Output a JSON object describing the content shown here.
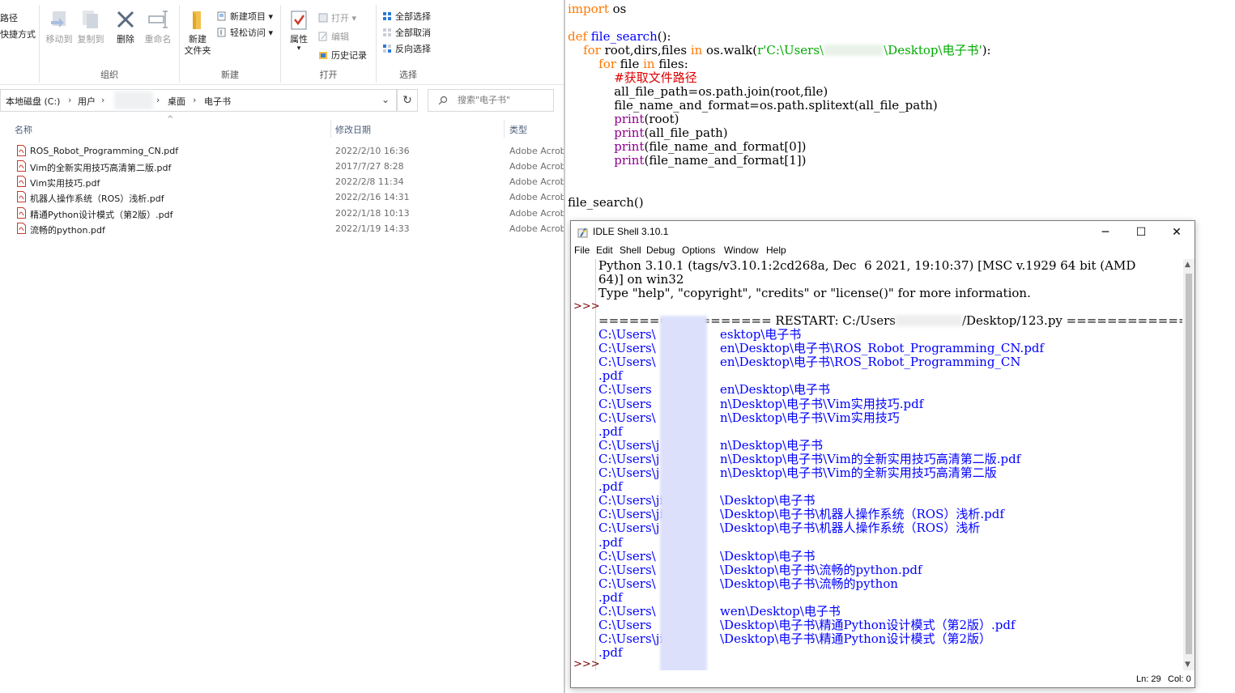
{
  "explorer": {
    "ribbon": {
      "cut_partial_label": "路径",
      "paste_shortcut_partial_label": "快捷方式",
      "move_to": "移动到",
      "copy_to": "复制到",
      "delete": "删除",
      "rename": "重命名",
      "new_folder_line1": "新建",
      "new_folder_line2": "文件夹",
      "new_item": "新建项目",
      "easy_access": "轻松访问",
      "properties": "属性",
      "open": "打开",
      "edit": "编辑",
      "history": "历史记录",
      "select_all": "全部选择",
      "select_none": "全部取消",
      "invert_selection": "反向选择",
      "groups": {
        "organize": "组织",
        "new": "新建",
        "open": "打开",
        "select": "选择"
      }
    },
    "breadcrumb": {
      "drive": "本地磁盘 (C:)",
      "users": "用户",
      "desktop": "桌面",
      "folder": "电子书"
    },
    "search_placeholder": "搜索\"电子书\"",
    "columns": {
      "name": "名称",
      "modified": "修改日期",
      "type": "类型"
    },
    "files": [
      {
        "name": "ROS_Robot_Programming_CN.pdf",
        "modified": "2022/2/10 16:36",
        "type": "Adobe Acrob"
      },
      {
        "name": "Vim的全新实用技巧高清第二版.pdf",
        "modified": "2017/7/27 8:28",
        "type": "Adobe Acrob"
      },
      {
        "name": "Vim实用技巧.pdf",
        "modified": "2022/2/8 11:34",
        "type": "Adobe Acrob"
      },
      {
        "name": "机器人操作系统（ROS）浅析.pdf",
        "modified": "2022/2/16 14:31",
        "type": "Adobe Acrob"
      },
      {
        "name": "精通Python设计模式（第2版）.pdf",
        "modified": "2022/1/18 10:13",
        "type": "Adobe Acrob"
      },
      {
        "name": "流畅的python.pdf",
        "modified": "2022/1/19 14:33",
        "type": "Adobe Acrob"
      }
    ]
  },
  "editor": {
    "l1_kw": "import",
    "l1_rest": " os",
    "l2_kw": "def",
    "l2_fn": " file_search",
    "l2_rest": "():",
    "l3_kw1": "    for",
    "l3_a": " root,dirs,files ",
    "l3_kw2": "in",
    "l3_b": " os.walk(",
    "l3_str1": "r'C:\\Users\\",
    "l3_str2": "\\Desktop\\电子书'",
    "l3_c": "):",
    "l4_kw1": "        for",
    "l4_a": " file ",
    "l4_kw2": "in",
    "l4_b": " files:",
    "l5_comment": "            #获取文件路径",
    "l6": "            all_file_path=os.path.join(root,file)",
    "l7": "            file_name_and_format=os.path.splitext(all_file_path)",
    "l8_kw": "            print",
    "l8_rest": "(root)",
    "l9_kw": "            print",
    "l9_rest": "(all_file_path)",
    "l10_kw": "            print",
    "l10_rest": "(file_name_and_format[0])",
    "l11_kw": "            print",
    "l11_rest": "(file_name_and_format[1])",
    "l12": "file_search()"
  },
  "shell": {
    "title": "IDLE Shell 3.10.1",
    "menus": [
      "File",
      "Edit",
      "Shell",
      "Debug",
      "Options",
      "Window",
      "Help"
    ],
    "prompt": ">>>",
    "banner1": "Python 3.10.1 (tags/v3.10.1:2cd268a, Dec  6 2021, 19:10:37) [MSC v.1929 64 bit (AMD",
    "banner2": "64)] on win32",
    "banner3": "Type \"help\", \"copyright\", \"credits\" or \"license()\" for more information.",
    "restart_a": "================= RESTART: C:/Users",
    "restart_b": "/Desktop/123.py ==================",
    "output": [
      "C:\\Users\\",
      "C:\\Users\\",
      "C:\\Users\\",
      ".pdf",
      "C:\\Users",
      "C:\\Users",
      "C:\\Users\\",
      ".pdf",
      "C:\\Users\\j",
      "C:\\Users\\j",
      "C:\\Users\\j",
      ".pdf",
      "C:\\Users\\ji",
      "C:\\Users\\ji",
      "C:\\Users\\j",
      ".pdf",
      "C:\\Users\\",
      "C:\\Users\\",
      "C:\\Users\\",
      ".pdf",
      "C:\\Users\\",
      "C:\\Users",
      "C:\\Users\\jing.",
      ".pdf"
    ],
    "output_tail": [
      "esktop\\电子书",
      "en\\Desktop\\电子书\\ROS_Robot_Programming_CN.pdf",
      "en\\Desktop\\电子书\\ROS_Robot_Programming_CN",
      "",
      "en\\Desktop\\电子书",
      "n\\Desktop\\电子书\\Vim实用技巧.pdf",
      "n\\Desktop\\电子书\\Vim实用技巧",
      "",
      "n\\Desktop\\电子书",
      "n\\Desktop\\电子书\\Vim的全新实用技巧高清第二版.pdf",
      "n\\Desktop\\电子书\\Vim的全新实用技巧高清第二版",
      "",
      "\\Desktop\\电子书",
      "\\Desktop\\电子书\\机器人操作系统（ROS）浅析.pdf",
      "\\Desktop\\电子书\\机器人操作系统（ROS）浅析",
      "",
      "\\Desktop\\电子书",
      "\\Desktop\\电子书\\流畅的python.pdf",
      "\\Desktop\\电子书\\流畅的python",
      "",
      "wen\\Desktop\\电子书",
      "\\Desktop\\电子书\\精通Python设计模式（第2版）.pdf",
      "\\Desktop\\电子书\\精通Python设计模式（第2版）",
      ""
    ],
    "status_ln": "Ln: 29",
    "status_col": "Col: 0"
  }
}
